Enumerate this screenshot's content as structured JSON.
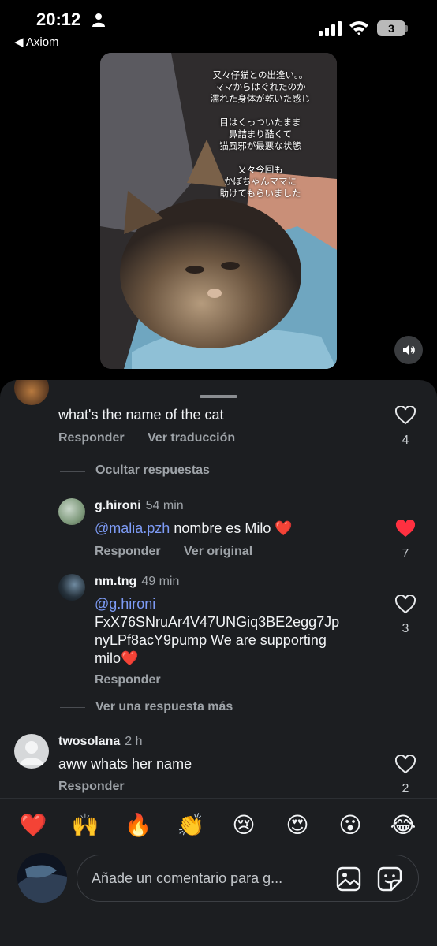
{
  "status_bar": {
    "time": "20:12",
    "back_app": "◀ Axiom",
    "battery": "3"
  },
  "video": {
    "caption_lines": [
      "又々仔猫との出逢い。。",
      "ママからはぐれたのか",
      "濡れた身体が乾いた感じ",
      "",
      "目はくっついたまま",
      "鼻詰まり酷くて",
      "猫風邪が最悪な状態",
      "",
      "又々今回も",
      "かぽちゃんママに",
      "助けてもらいました"
    ]
  },
  "comments": {
    "top": {
      "text": "what's the name of the cat",
      "reply_label": "Responder",
      "translate_label": "Ver traducción",
      "likes": "4",
      "hide_replies_label": "Ocultar respuestas"
    },
    "reply1": {
      "username": "g.hironi",
      "ago": "54 min",
      "mention": "@malia.pzh",
      "text": " nombre es Milo ❤️",
      "reply_label": "Responder",
      "original_label": "Ver original",
      "likes": "7"
    },
    "reply2": {
      "username": "nm.tng",
      "ago": "49 min",
      "mention": "@g.hironi",
      "line1": "FxX76SNruAr4V47UNGiq3BE2egg7Jp",
      "line2": "nyLPf8acY9pump  We are supporting",
      "line3": "milo❤️",
      "reply_label": "Responder",
      "likes": "3"
    },
    "more_replies_label": "Ver una respuesta más",
    "comment3": {
      "username": "twosolana",
      "ago": "2 h",
      "text": "aww whats her name",
      "reply_label": "Responder",
      "likes": "2"
    }
  },
  "emoji_bar": [
    "❤️",
    "🙌",
    "🔥",
    "👏",
    "😢",
    "😍",
    "😮",
    "😂"
  ],
  "composer": {
    "placeholder": "Añade un comentario para g..."
  },
  "colors": {
    "sheet_bg": "#1c1e21",
    "mention": "#7d9bf5",
    "liked_heart": "#ff3040"
  }
}
